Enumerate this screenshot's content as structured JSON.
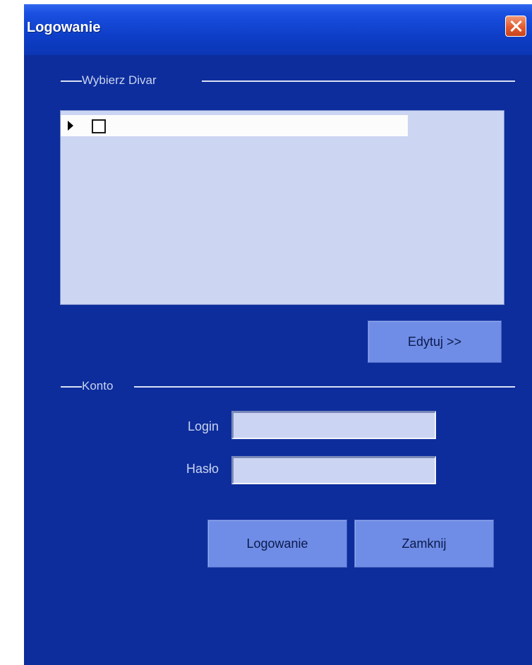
{
  "window": {
    "title": "Logowanie",
    "close_icon": "close-icon",
    "colors": {
      "background": "#0d2d9c",
      "titlebar": "#1a4fe0",
      "close_button": "#e25a2d",
      "button": "#6f8de6",
      "field": "#cbd4f2",
      "grid": "#ccd5f2"
    }
  },
  "divar_group": {
    "label": "Wybierz Divar",
    "rows": [
      {
        "pointer_icon": "row-pointer-icon",
        "checked": false
      }
    ],
    "edit_button_label": "Edytuj >>"
  },
  "account_group": {
    "label": "Konto",
    "login_label": "Login",
    "login_value": "",
    "password_label": "Hasło",
    "password_value": ""
  },
  "actions": {
    "login_button_label": "Logowanie",
    "close_button_label": "Zamknij"
  }
}
